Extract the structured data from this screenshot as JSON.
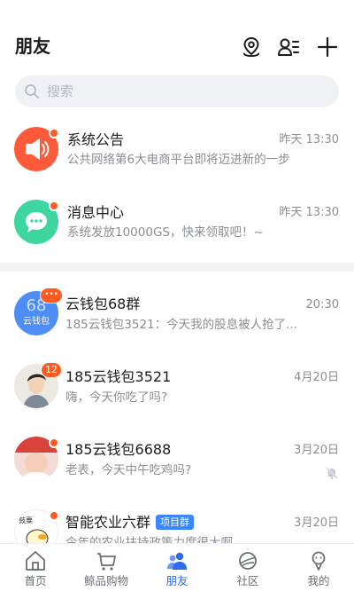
{
  "header": {
    "title": "朋友"
  },
  "search": {
    "placeholder": "搜索"
  },
  "system_items": [
    {
      "name": "系统公告",
      "preview": "公共网络第6大电商平台即将迈进新的一步",
      "time": "昨天 13:30",
      "icon": "speaker-icon",
      "color": "#ff5b3a"
    },
    {
      "name": "消息中心",
      "preview": "系统发放10000GS，快来领取吧！~",
      "time": "昨天 13:30",
      "icon": "chat-bubble-icon",
      "color": "#3ed6a0"
    }
  ],
  "chats": [
    {
      "name": "云钱包68群",
      "preview": "185云钱包3521：今天我的股息被人抢了...",
      "time": "20:30",
      "avatar_text_top": "68",
      "avatar_text_bottom": "云钱包",
      "badge": "•••"
    },
    {
      "name": "185云钱包3521",
      "preview": "嗨，今天你吃了吗?",
      "time": "4月20日",
      "badge": "12"
    },
    {
      "name": "185云钱包6688",
      "preview": "老表，今天中午吃鸡吗?",
      "time": "3月20日",
      "muted": true
    },
    {
      "name": "智能农业六群",
      "tag": "项目群",
      "preview": "今年的农业扶持政策力度很大啊",
      "time": "3月20日",
      "avatar_text": "鼓粟"
    }
  ],
  "tabs": [
    {
      "label": "首页",
      "icon": "home-icon"
    },
    {
      "label": "鲸品购物",
      "icon": "cart-icon"
    },
    {
      "label": "朋友",
      "icon": "friends-icon",
      "active": true
    },
    {
      "label": "社区",
      "icon": "planet-icon"
    },
    {
      "label": "我的",
      "icon": "profile-icon"
    }
  ],
  "colors": {
    "accent": "#2f6bf0",
    "notify": "#ff5a1f",
    "tag": "#3a86ff"
  }
}
